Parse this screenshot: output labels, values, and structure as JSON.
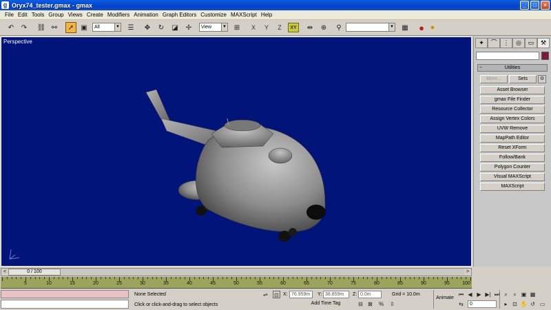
{
  "window": {
    "title": "Oryx74_tester.gmax - gmax",
    "icon": "gmax-logo-icon"
  },
  "menu": [
    "File",
    "Edit",
    "Tools",
    "Group",
    "Views",
    "Create",
    "Modifiers",
    "Animation",
    "Graph Editors",
    "Customize",
    "MAXScript",
    "Help"
  ],
  "toolbar": {
    "selection_filter": "All",
    "reference_coord": "View",
    "axis_x": "X",
    "axis_y": "Y",
    "axis_z": "Z",
    "axis_xy": "XY",
    "named_selection": ""
  },
  "viewport": {
    "label": "Perspective",
    "background": "#00147a"
  },
  "command_panel": {
    "rollout_title": "Utilities",
    "more_label": "More...",
    "sets_label": "Sets",
    "utilities": [
      "Asset Browser",
      "gmax File Finder",
      "Resource Collector",
      "Assign Vertex Colors",
      "UVW Remove",
      "MapPath Editor",
      "Reset XForm",
      "Follow/Bank",
      "Polygon Counter",
      "Visual MAXScript",
      "MAXScript"
    ]
  },
  "timeline": {
    "frame_display": "0 / 100",
    "ticks": [
      "5",
      "10",
      "15",
      "20",
      "25",
      "30",
      "35",
      "40",
      "45",
      "50",
      "55",
      "60",
      "65",
      "70",
      "75",
      "80",
      "85",
      "90",
      "95",
      "100"
    ]
  },
  "status": {
    "selection": "None Selected",
    "prompt": "Click or click-and-drag to select objects",
    "x_label": "X:",
    "x_value": "76.959m",
    "y_label": "Y:",
    "y_value": "38.859m",
    "z_label": "Z:",
    "z_value": "0.0m",
    "grid": "Grid = 10.0m",
    "add_time_tag": "Add Time Tag",
    "animate": "Animate",
    "frame_field": "0"
  }
}
